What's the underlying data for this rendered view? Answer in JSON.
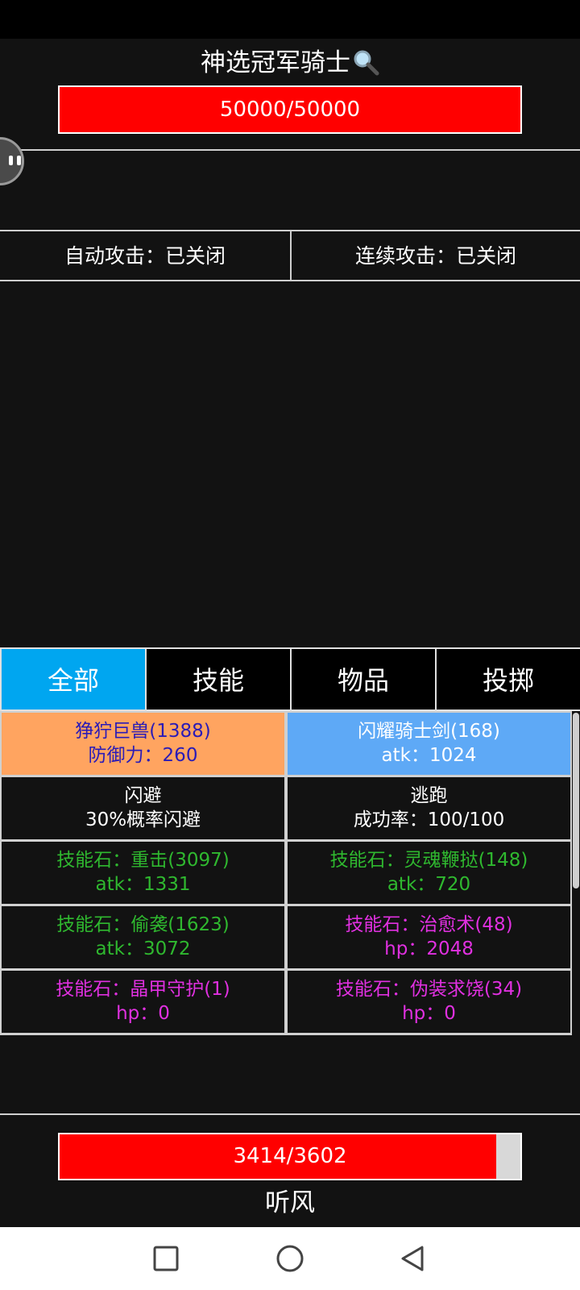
{
  "enemy": {
    "name": "神选冠军骑士",
    "hp_text": "50000/50000",
    "hp_fraction": 1.0
  },
  "toggles": {
    "auto_attack": "自动攻击：已关闭",
    "continuous_attack": "连续攻击：已关闭"
  },
  "tabs": [
    {
      "label": "全部",
      "active": true
    },
    {
      "label": "技能",
      "active": false
    },
    {
      "label": "物品",
      "active": false
    },
    {
      "label": "投掷",
      "active": false
    }
  ],
  "cards": [
    {
      "line1": "狰狞巨兽(1388)",
      "line2": "防御力：260",
      "style": "orange"
    },
    {
      "line1": "闪耀骑士剑(168)",
      "line2": "atk：1024",
      "style": "blue"
    },
    {
      "line1": "闪避",
      "line2": "30%概率闪避",
      "style": "white"
    },
    {
      "line1": "逃跑",
      "line2": "成功率：100/100",
      "style": "white"
    },
    {
      "line1": "技能石：重击(3097)",
      "line2": "atk：1331",
      "style": "green"
    },
    {
      "line1": "技能石：灵魂鞭挞(148)",
      "line2": "atk：720",
      "style": "green"
    },
    {
      "line1": "技能石：偷袭(1623)",
      "line2": "atk：3072",
      "style": "green"
    },
    {
      "line1": "技能石：治愈术(48)",
      "line2": "hp：2048",
      "style": "magenta"
    },
    {
      "line1": "技能石：晶甲守护(1)",
      "line2": "hp：0",
      "style": "magenta"
    },
    {
      "line1": "技能石：伪装求饶(34)",
      "line2": "hp：0",
      "style": "magenta"
    }
  ],
  "player": {
    "name": "听风",
    "hp_text": "3414/3602",
    "hp_fraction": 0.9478
  },
  "colors": {
    "hp_fill": "#ff0000",
    "tab_active": "#00a6f0",
    "card_orange": "#ffa460",
    "card_blue": "#5ea9f6",
    "text_green": "#2fb82f",
    "text_magenta": "#e030e0"
  },
  "icons": {
    "title_icon": "magnifier-icon",
    "floating_button": "chat-bubble-icon",
    "nav": [
      "recent-apps-icon",
      "home-icon",
      "back-icon"
    ]
  }
}
